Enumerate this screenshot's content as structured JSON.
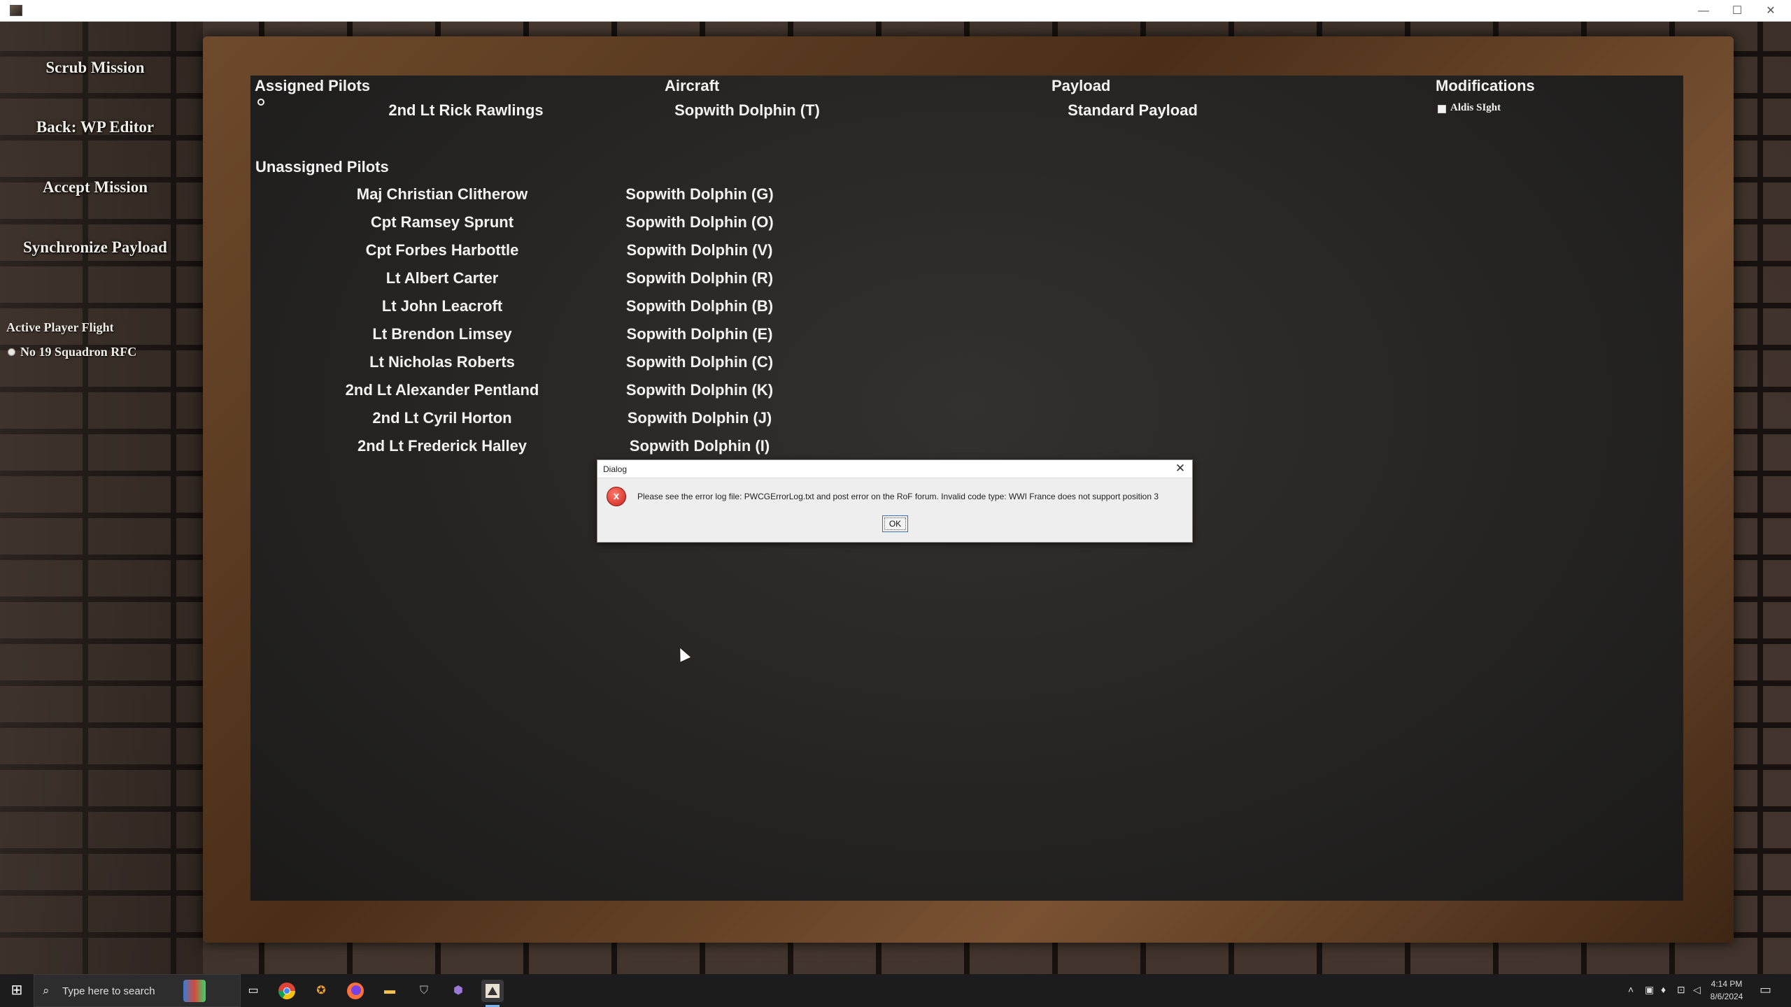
{
  "window": {
    "minimize_glyph": "—",
    "maximize_glyph": "☐",
    "close_glyph": "✕"
  },
  "sidebar": {
    "scrub_label": "Scrub Mission",
    "back_label": "Back: WP Editor",
    "accept_label": "Accept Mission",
    "sync_label": "Synchronize Payload",
    "flight_heading": "Active Player Flight",
    "flight_name": "No 19 Squadron RFC"
  },
  "board": {
    "headers": {
      "assigned": "Assigned Pilots",
      "aircraft": "Aircraft",
      "payload": "Payload",
      "modifications": "Modifications",
      "unassigned": "Unassigned Pilots"
    },
    "assigned": {
      "pilot": "2nd Lt Rick Rawlings",
      "aircraft": "Sopwith Dolphin (T)",
      "payload": "Standard Payload",
      "modification": "Aldis SIght"
    },
    "unassigned_pilots": [
      "Maj Christian Clitherow",
      "Cpt Ramsey Sprunt",
      "Cpt Forbes Harbottle",
      "Lt Albert Carter",
      "Lt John Leacroft",
      "Lt Brendon Limsey",
      "Lt Nicholas Roberts",
      "2nd Lt Alexander Pentland",
      "2nd Lt Cyril Horton",
      "2nd Lt Frederick Halley"
    ],
    "unassigned_aircraft": [
      "Sopwith Dolphin (G)",
      "Sopwith Dolphin (O)",
      "Sopwith Dolphin (V)",
      "Sopwith Dolphin (R)",
      "Sopwith Dolphin (B)",
      "Sopwith Dolphin (E)",
      "Sopwith Dolphin (C)",
      "Sopwith Dolphin (K)",
      "Sopwith Dolphin (J)",
      "Sopwith Dolphin (I)"
    ]
  },
  "dialog": {
    "title": "Dialog",
    "close_glyph": "✕",
    "icon": "error-icon",
    "icon_glyph": "x",
    "message": "Please see the error log file: PWCGErrorLog.txt and post error on the RoF forum.  Invalid code type: WWI France does not support position 3",
    "ok_label": "OK"
  },
  "taskbar": {
    "start_glyph": "⊞",
    "search_glyph": "⌕",
    "search_placeholder": "Type here to search",
    "clock_time": "4:14 PM",
    "clock_date": "8/6/2024"
  },
  "colors": {
    "chalk_text": "#f2f2f2",
    "board": "#262524",
    "frame_wood": "#5a3a20",
    "error_red": "#d42a20"
  }
}
